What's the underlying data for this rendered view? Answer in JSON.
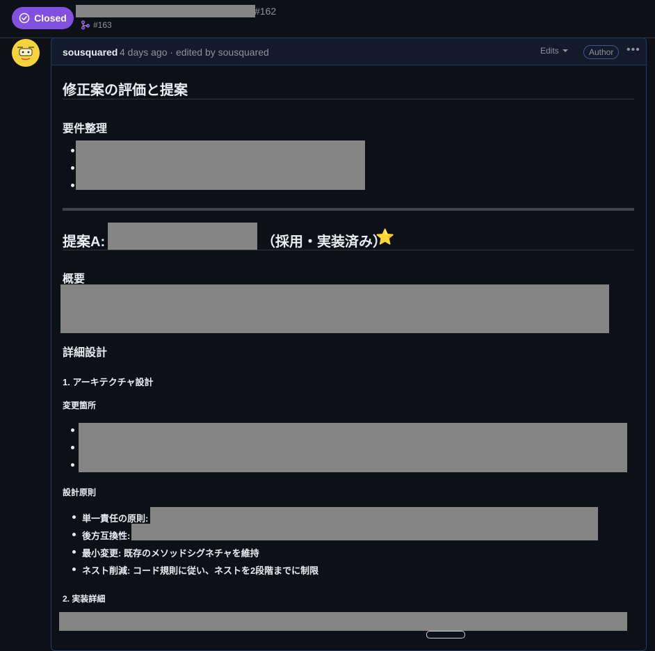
{
  "header": {
    "status_label": "Closed",
    "status_color": "#8250df",
    "issue_number": "#162",
    "linked_pr": "#163"
  },
  "comment": {
    "author": "sousquared",
    "meta": "4 days ago · edited by sousquared",
    "edits_label": "Edits",
    "author_badge": "Author",
    "more_icon": "kebab-horizontal-icon"
  },
  "body": {
    "h_evaluation": "修正案の評価と提案",
    "h_requirements": "要件整理",
    "h_proposal_prefix": "提案A:",
    "h_proposal_suffix": "（採用・実装済み）",
    "star_emoji": "⭐",
    "h_overview": "概要",
    "h_detail": "詳細設計",
    "h_arch": "1. アーキテクチャ設計",
    "h_changes": "変更箇所",
    "h_principles": "設計原則",
    "principles": [
      "単一責任の原則:",
      "後方互換性:",
      "最小変更: 既存のメソッドシグネチャを維持",
      "ネスト削減: コード規則に従い、ネストを2段階までに制限"
    ],
    "h_impl": "2. 実装詳細"
  }
}
